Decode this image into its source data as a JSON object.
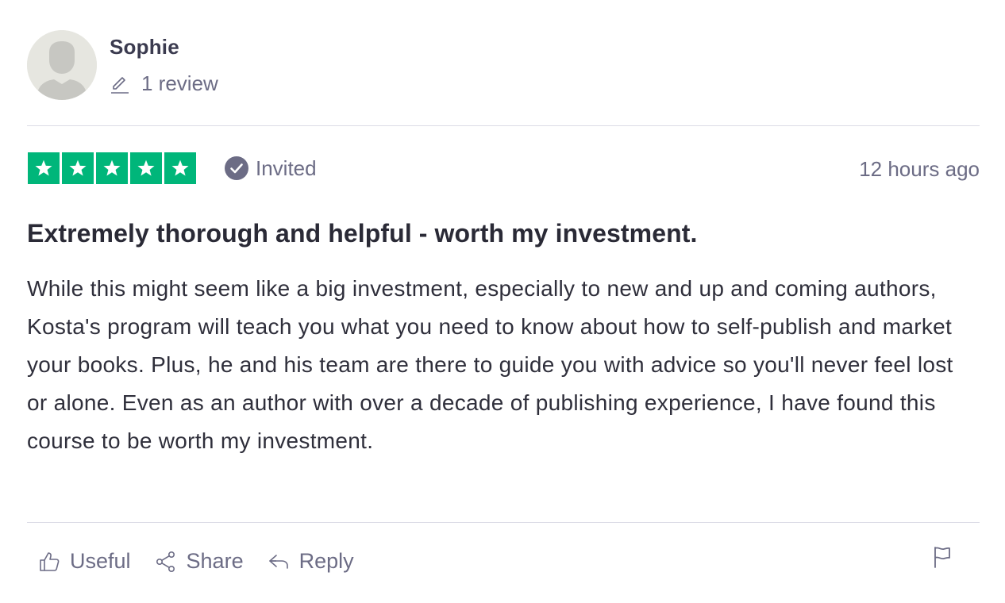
{
  "reviewer": {
    "name": "Sophie",
    "review_count": "1 review",
    "avatar_icon": "default-user-avatar-icon",
    "review_count_icon": "pencil-icon"
  },
  "rating": {
    "stars": 5,
    "max_stars": 5,
    "star_color": "#00b67a"
  },
  "badge": {
    "label": "Invited",
    "icon": "check-circle-icon"
  },
  "date": "12 hours ago",
  "review": {
    "title": "Extremely thorough and helpful - worth my investment.",
    "body": "While this might seem like a big investment, especially to new and up and coming authors, Kosta's program will teach you what you need to know about how to self-publish and market your books. Plus, he and his team are there to guide you with advice so you'll never feel lost or alone. Even as an author with over a decade of publishing experience, I have found this course to be worth my investment."
  },
  "actions": {
    "useful": {
      "label": "Useful",
      "icon": "thumbs-up-icon"
    },
    "share": {
      "label": "Share",
      "icon": "share-icon"
    },
    "reply": {
      "label": "Reply",
      "icon": "reply-icon"
    },
    "report": {
      "icon": "flag-icon"
    }
  }
}
